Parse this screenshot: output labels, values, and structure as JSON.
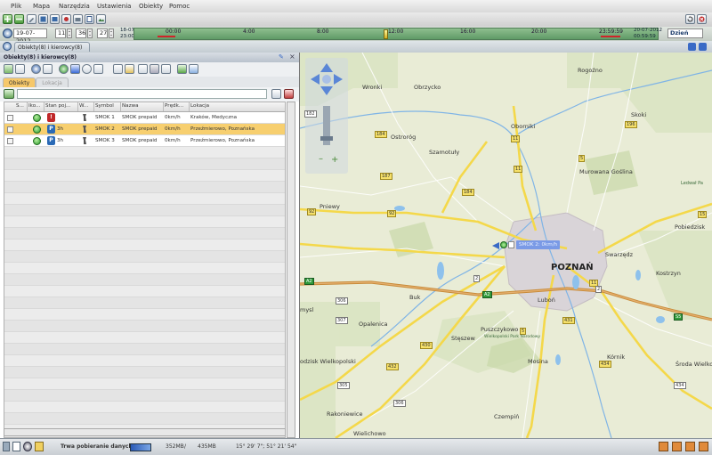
{
  "menu": [
    "Plik",
    "Mapa",
    "Narzędzia",
    "Ustawienia",
    "Obiekty",
    "Pomoc"
  ],
  "datebar": {
    "date": "19-07-2012",
    "hour": "11",
    "minute": "36",
    "second": "27",
    "range_start_date": "18-07-2012",
    "range_start_time": "23:00:00",
    "range_end_date": "20-07-2012",
    "range_end_time": "00:59:59",
    "period_value": "Dzień",
    "timeline_labels": [
      "00:00",
      "4:00",
      "8:00",
      "12:00",
      "16:00",
      "20:00",
      "23:59:59"
    ]
  },
  "tab": {
    "label": "Obiekty(8) i kierowcy(8)"
  },
  "panel": {
    "title": "Obiekty(8) i kierowcy(8)",
    "subtabs": [
      "Obiekty",
      "Lokacja"
    ],
    "search_value": "",
    "columns": [
      "S...",
      "Iko...",
      "Stan poj...",
      "W...",
      "Symbol",
      "Nazwa",
      "Prędk...",
      "Lokacja"
    ],
    "rows": [
      {
        "status_icon": "red",
        "time": "",
        "symbol": "SMOK 1",
        "name": "SMOK prepaid",
        "speed": "0km/h",
        "location": "Kraków, Medyczna",
        "selected": false
      },
      {
        "status_icon": "blue",
        "time": "3h",
        "symbol": "SMOK 2",
        "name": "SMOK prepaid",
        "speed": "0km/h",
        "location": "Przeźmierowo, Poznańska",
        "selected": true
      },
      {
        "status_icon": "blue",
        "time": "3h",
        "symbol": "SMOK 3",
        "name": "SMOK prepaid",
        "speed": "0km/h",
        "location": "Przeźmierowo, Poznańska",
        "selected": false
      }
    ]
  },
  "map": {
    "places": [
      "Wronki",
      "Obrzycko",
      "Rogoźno",
      "Skoki",
      "Oborniki",
      "Ostroróg",
      "Szamotuły",
      "Murowana Goślina",
      "Pniewy",
      "Pobiedzisk",
      "Swarzędz",
      "POZNAŃ",
      "Kostrzyn",
      "Buk",
      "Luboń",
      "Opalenica",
      "Puszczykowo",
      "Stęszew",
      "Mosina",
      "Kórnik",
      "Środa Wielko",
      "odzisk Wielkopolski",
      "Rakoniewice",
      "Czempiń",
      "Wielichowo",
      "mysl"
    ],
    "marker_label": "SMOK 2: 0km/h",
    "park_label": "Wielkopolski Park Narodowy",
    "park_label2": "Ledwał Pa",
    "road_numbers": [
      "182",
      "184",
      "11",
      "187",
      "196",
      "11",
      "92",
      "92",
      "184",
      "5",
      "306",
      "307",
      "430",
      "5",
      "431",
      "432",
      "305",
      "306",
      "434",
      "434",
      "11",
      "15",
      "2",
      "2",
      "A2",
      "A2",
      "S5"
    ]
  },
  "status": {
    "progress_label": "Trwa pobieranie danych",
    "memory_used": "352MB",
    "memory_total": "435MB",
    "coords": "15° 29' 7\"; 51° 21' 54\""
  }
}
